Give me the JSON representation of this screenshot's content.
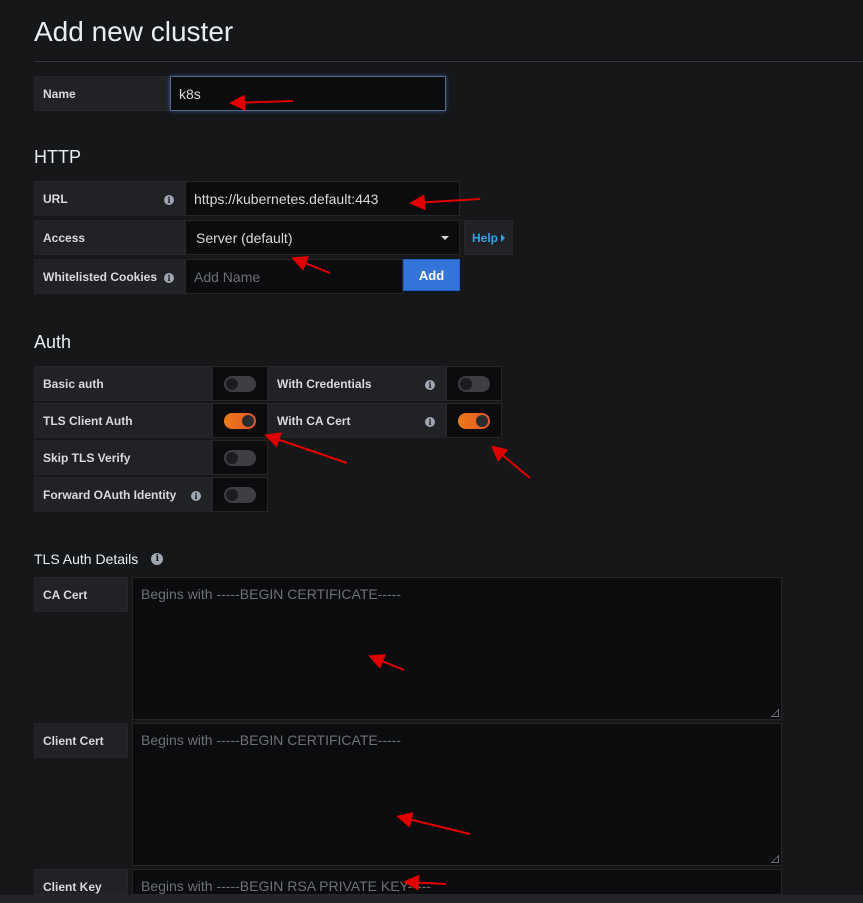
{
  "page": {
    "title": "Add new cluster"
  },
  "name_field": {
    "label": "Name",
    "value": "k8s"
  },
  "http": {
    "title": "HTTP",
    "url_label": "URL",
    "url_value": "https://kubernetes.default:443",
    "access_label": "Access",
    "access_value": "Server (default)",
    "help_label": "Help",
    "cookies_label": "Whitelisted Cookies",
    "cookies_placeholder": "Add Name",
    "add_label": "Add"
  },
  "auth": {
    "title": "Auth",
    "basic_auth": {
      "label": "Basic auth",
      "enabled": false
    },
    "with_credentials": {
      "label": "With Credentials",
      "enabled": false
    },
    "tls_client_auth": {
      "label": "TLS Client Auth",
      "enabled": true
    },
    "with_ca_cert": {
      "label": "With CA Cert",
      "enabled": true
    },
    "skip_tls_verify": {
      "label": "Skip TLS Verify",
      "enabled": false
    },
    "forward_oauth": {
      "label": "Forward OAuth Identity",
      "enabled": false
    }
  },
  "tls": {
    "title": "TLS Auth Details",
    "ca_cert_label": "CA Cert",
    "ca_cert_placeholder": "Begins with -----BEGIN CERTIFICATE-----",
    "client_cert_label": "Client Cert",
    "client_cert_placeholder": "Begins with -----BEGIN CERTIFICATE-----",
    "client_key_label": "Client Key",
    "client_key_placeholder": "Begins with -----BEGIN RSA PRIVATE KEY-----"
  },
  "colors": {
    "background": "#161719",
    "accent_blue": "#3274d9",
    "toggle_on": "#eb7b18",
    "annotation_arrow": "#e00000"
  },
  "icons": [
    "info-icon",
    "caret-down-icon",
    "caret-right-icon",
    "resize-grip-icon",
    "annotation-arrow-icon"
  ]
}
